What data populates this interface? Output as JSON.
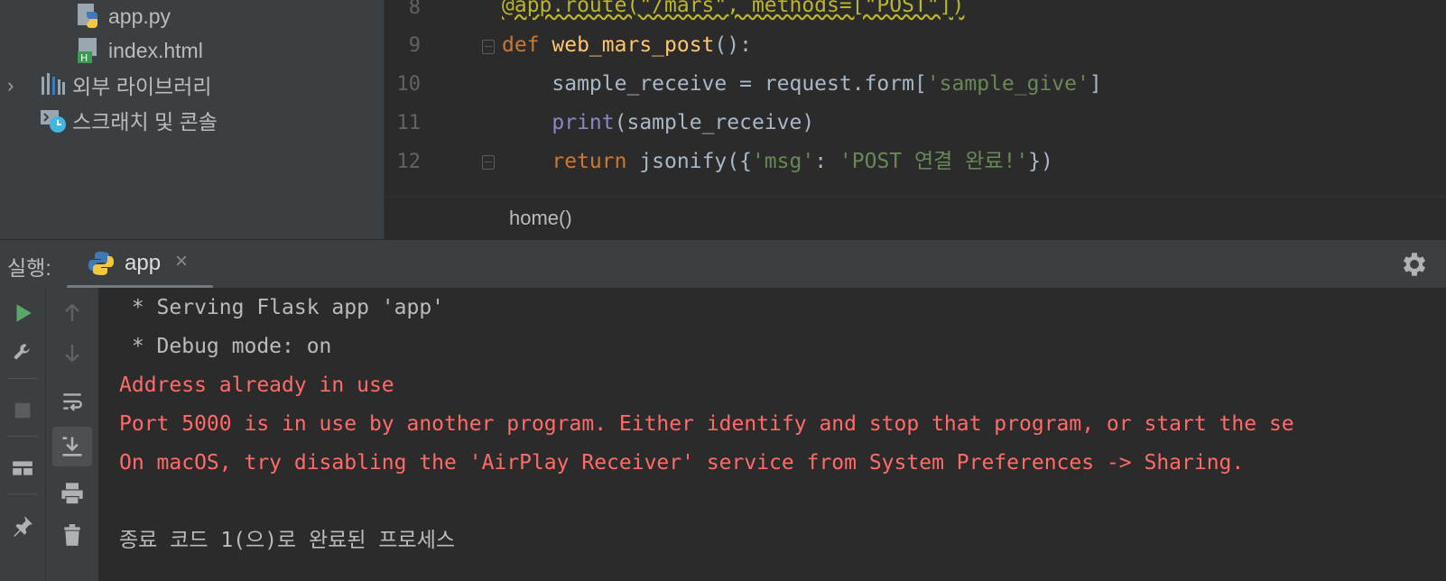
{
  "project_tree": {
    "items": [
      {
        "label": "app.py",
        "icon": "python-file-icon"
      },
      {
        "label": "index.html",
        "icon": "html-file-icon"
      },
      {
        "label": "외부 라이브러리",
        "icon": "library-icon"
      },
      {
        "label": "스크래치 및 콘솔",
        "icon": "scratch-icon"
      }
    ]
  },
  "editor": {
    "line_numbers": [
      "8",
      "9",
      "10",
      "11",
      "12"
    ],
    "lines": [
      [
        {
          "t": "@app.route(\"/mars\", methods=[\"POST\"])",
          "c": "dec"
        }
      ],
      [
        {
          "t": "def ",
          "c": "kw"
        },
        {
          "t": "web_mars_post",
          "c": "fn"
        },
        {
          "t": "():",
          "c": "plain"
        }
      ],
      [
        {
          "t": "    sample_receive = request.form[",
          "c": "plain"
        },
        {
          "t": "'sample_give'",
          "c": "str"
        },
        {
          "t": "]",
          "c": "plain"
        }
      ],
      [
        {
          "t": "    ",
          "c": "plain"
        },
        {
          "t": "print",
          "c": "bi"
        },
        {
          "t": "(sample_receive)",
          "c": "plain"
        }
      ],
      [
        {
          "t": "    ",
          "c": "plain"
        },
        {
          "t": "return ",
          "c": "kw"
        },
        {
          "t": "jsonify({",
          "c": "plain"
        },
        {
          "t": "'msg'",
          "c": "str"
        },
        {
          "t": ": ",
          "c": "plain"
        },
        {
          "t": "'POST 연결 완료!'",
          "c": "str"
        },
        {
          "t": "})",
          "c": "plain"
        }
      ]
    ],
    "breadcrumb": "home()"
  },
  "run_panel": {
    "label": "실행:",
    "tab_label": "app",
    "close_glyph": "×",
    "console_lines": [
      {
        "text": " * Serving Flask app 'app'",
        "type": "normal"
      },
      {
        "text": " * Debug mode: on",
        "type": "normal"
      },
      {
        "text": "Address already in use",
        "type": "error"
      },
      {
        "text": "Port 5000 is in use by another program. Either identify and stop that program, or start the se",
        "type": "error"
      },
      {
        "text": "On macOS, try disabling the 'AirPlay Receiver' service from System Preferences -> Sharing.",
        "type": "error"
      },
      {
        "text": "",
        "type": "normal"
      },
      {
        "text": "종료 코드 1(으)로 완료된 프로세스",
        "type": "normal"
      }
    ]
  },
  "colors": {
    "background": "#2b2b2b",
    "panel": "#3c3f41",
    "error_text": "#ff6b68",
    "run_green": "#59a869",
    "python_blue": "#3d7ab7",
    "python_yellow": "#f5c73b"
  }
}
